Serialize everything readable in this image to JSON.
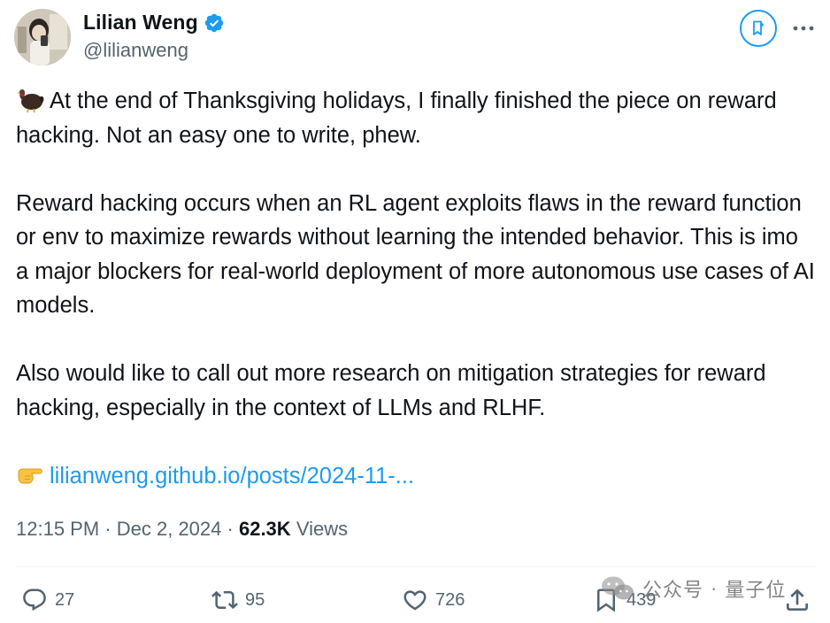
{
  "author": {
    "display_name": "Lilian Weng",
    "handle": "@lilianweng",
    "verified": true
  },
  "header_buttons": {
    "grok_icon": "grok-bookmark-icon",
    "more_icon": "more-dots-icon"
  },
  "tweet": {
    "para1_emoji": "turkey",
    "para1": "At the end of Thanksgiving holidays, I finally finished the piece on reward hacking. Not an easy one to write, phew.",
    "para2": "Reward hacking occurs when an RL agent exploits flaws in the reward function or env to maximize rewards without learning the intended behavior. This is imo a major blockers for real-world deployment of more autonomous use cases of AI models.",
    "para3": "Also would like to call out more research on mitigation strategies for reward hacking, especially in the context of LLMs and RLHF.",
    "link_emoji": "pointing-right-hand",
    "link_text": "lilianweng.github.io/posts/2024-11-..."
  },
  "meta": {
    "time": "12:15 PM",
    "separator": "·",
    "date": "Dec 2, 2024",
    "views_count": "62.3K",
    "views_label": "Views"
  },
  "actions": {
    "replies": "27",
    "reposts": "95",
    "likes": "726",
    "bookmarks": "439"
  },
  "watermark": {
    "text1": "公众号",
    "dot": "·",
    "text2": "量子位"
  },
  "colors": {
    "accent": "#1d9bf0",
    "text": "#0f1419",
    "secondary": "#536471"
  }
}
